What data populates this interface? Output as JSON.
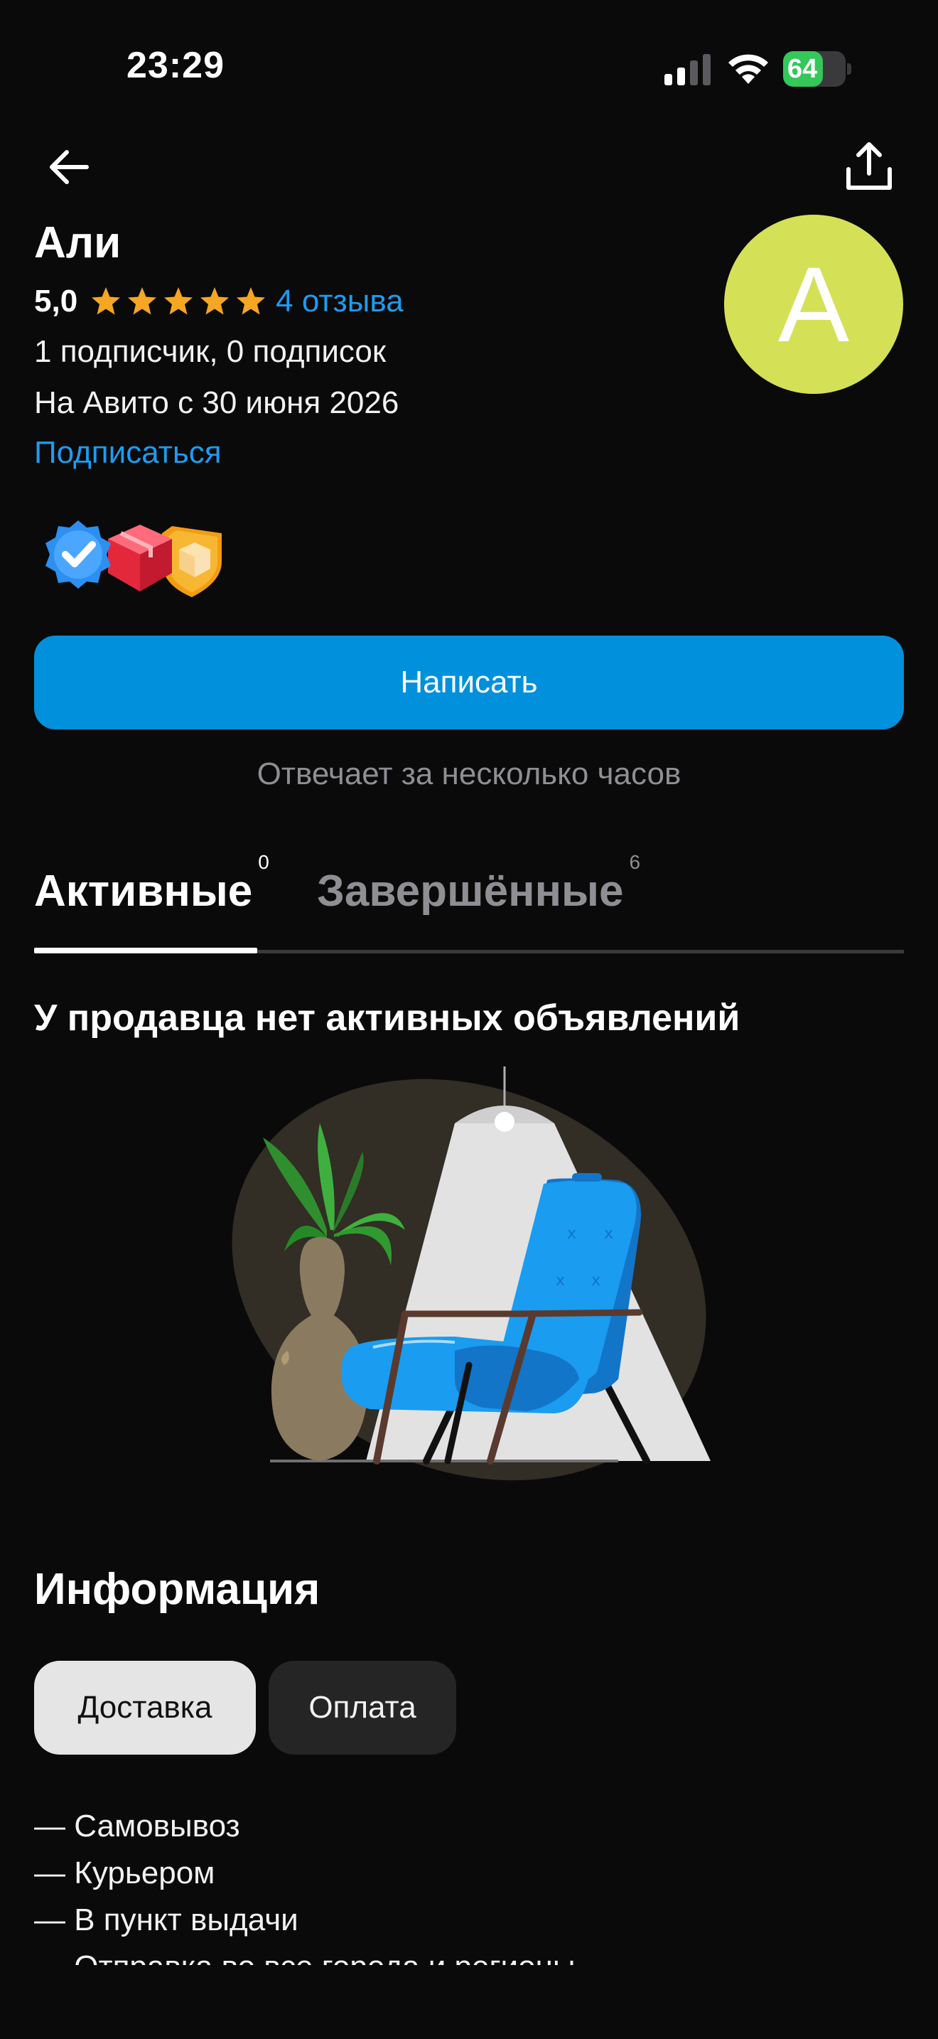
{
  "status_bar": {
    "time": "23:29",
    "battery_level": "64",
    "battery_fraction": 0.64,
    "signal_icon": "cellular-signal-icon",
    "wifi_icon": "wifi-icon",
    "battery_icon": "battery-charging-icon"
  },
  "nav": {
    "back_icon": "arrow-left-icon",
    "share_icon": "share-icon"
  },
  "profile": {
    "name": "Али",
    "rating": "5,0",
    "stars": 5,
    "reviews_link": "4 отзыва",
    "followers": "1 подписчик, 0 подписок",
    "since": "На Авито с 30 июня 2026",
    "subscribe_label": "Подписаться",
    "avatar_letter": "А",
    "avatar_color": "#d4e157",
    "badges": [
      "verified-badge-icon",
      "red-box-badge-icon",
      "orange-box-shield-badge-icon"
    ]
  },
  "actions": {
    "write_label": "Написать",
    "response_time": "Отвечает за несколько часов"
  },
  "tabs": [
    {
      "label": "Активные",
      "count": "0"
    },
    {
      "label": "Завершённые",
      "count": "6"
    }
  ],
  "empty_state": {
    "title": "У продавца нет активных объявлений",
    "illustration": "armchair-lamp-plant-illustration"
  },
  "info": {
    "title": "Информация",
    "chips": [
      "Доставка",
      "Оплата"
    ],
    "delivery_options": [
      "— Самовывоз",
      "— Курьером",
      "— В пункт выдачи",
      "— Отправка во все города и регионы"
    ]
  },
  "colors": {
    "background": "#0a0a0a",
    "accent_blue": "#0090dc",
    "link_blue": "#1e9bf0",
    "star": "#f5a623"
  }
}
